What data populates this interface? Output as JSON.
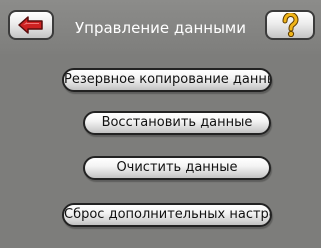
{
  "header": {
    "title": "Управление данными",
    "back_icon": "back-arrow-icon",
    "help_icon": "question-mark-icon"
  },
  "menu": {
    "items": [
      {
        "label": "Резервное копирование данных"
      },
      {
        "label": "Восстановить данные"
      },
      {
        "label": "Очистить данные"
      },
      {
        "label": "Сброс дополнительных настроек"
      }
    ]
  },
  "colors": {
    "background": "#7d7d7b",
    "arrow": "#cc2222",
    "question_mark": "#f0b418"
  }
}
